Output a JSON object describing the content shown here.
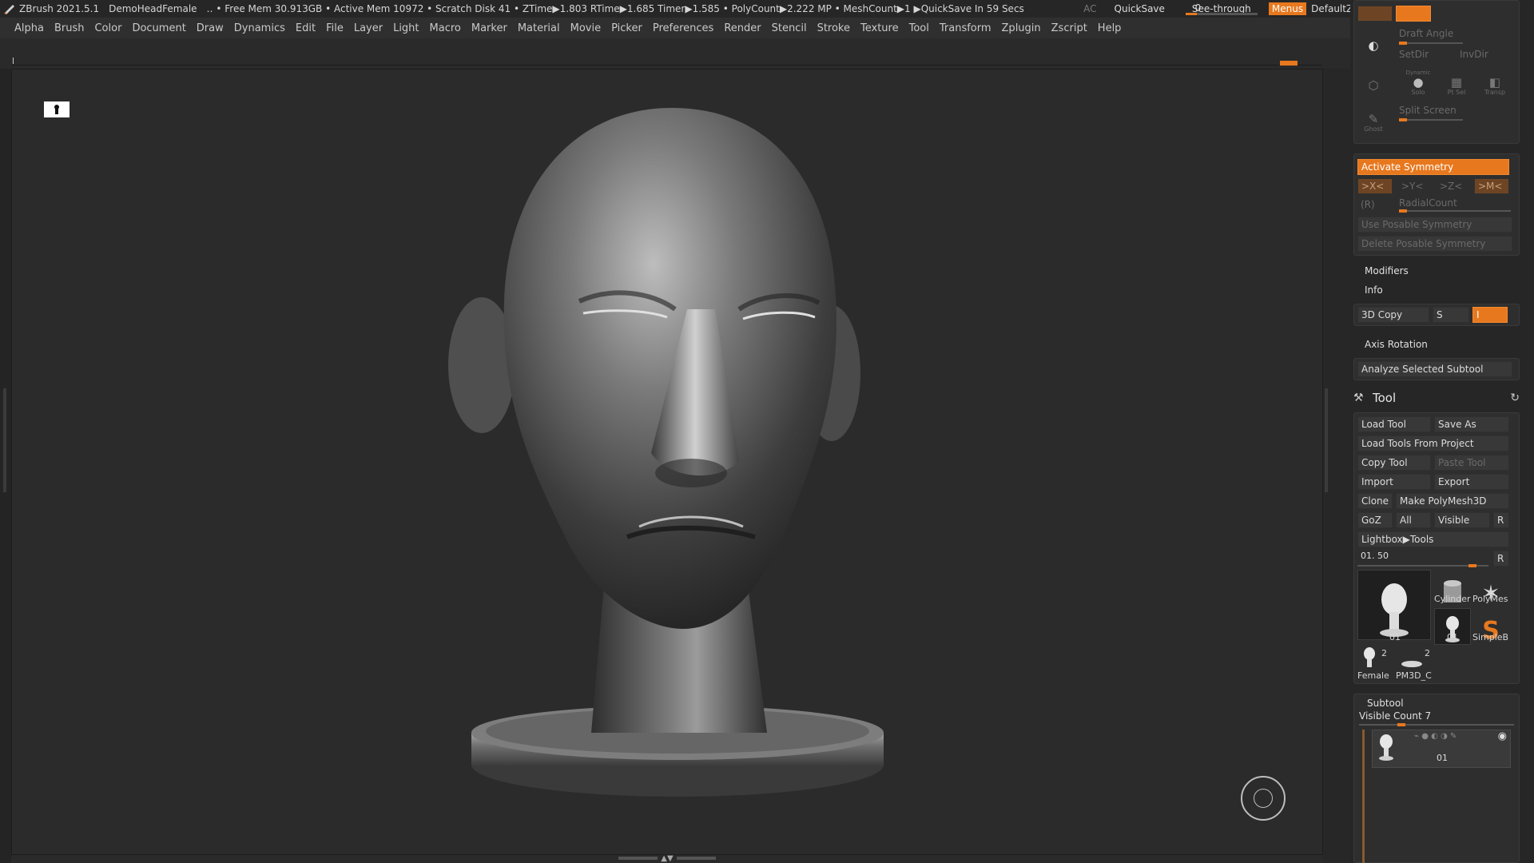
{
  "titlebar": {
    "app": "ZBrush 2021.5.1",
    "document": "DemoHeadFemale",
    "stats": "‥ • Free Mem 30.913GB • Active Mem 10972 • Scratch Disk 41 • ZTime▶1.803 RTime▶1.685 Timer▶1.585 • PolyCount▶2.222 MP • MeshCount▶1 ▶QuickSave In 59 Secs",
    "ac": "AC",
    "quicksave": "QuickSave",
    "see_through_label": "See-through",
    "see_through_value": "0",
    "see_through_fraction": 0.0,
    "menus": "Menus",
    "default_zscript": "DefaultZScript"
  },
  "menubar": {
    "items": [
      "Alpha",
      "Brush",
      "Color",
      "Document",
      "Draw",
      "Dynamics",
      "Edit",
      "File",
      "Layer",
      "Light",
      "Macro",
      "Marker",
      "Material",
      "Movie",
      "Picker",
      "Preferences",
      "Render",
      "Stencil",
      "Stroke",
      "Texture",
      "Tool",
      "Transform",
      "Zplugin",
      "Zscript",
      "Help"
    ]
  },
  "colors": {
    "accent": "#e8781e",
    "panel_bg": "#262626",
    "canvas_bg": "#2b2b2b",
    "button_bg": "#383838"
  },
  "panel": {
    "draft_angle": "Draft Angle",
    "set_dir": "SetDir",
    "inv_dir": "InvDir",
    "dynamic": "Dynamic",
    "solo": "Solo",
    "pt_sel": "Pt Sel",
    "transp": "Transp",
    "ghost": "Ghost",
    "split_screen": "Split Screen",
    "activate_symmetry": "Activate Symmetry",
    "sym_x": ">X<",
    "sym_y": ">Y<",
    "sym_z": ">Z<",
    "sym_m": ">M<",
    "sym_r": "(R)",
    "radial_count": "RadialCount",
    "use_posable_symmetry": "Use Posable Symmetry",
    "delete_posable_symmetry": "Delete Posable Symmetry",
    "modifiers": "Modifiers",
    "info": "Info",
    "copy_3d": "3D Copy",
    "copy_s": "S",
    "copy_i": "I",
    "axis_rotation": "Axis Rotation",
    "analyze_selected_subtool": "Analyze Selected Subtool"
  },
  "tool": {
    "title": "Tool",
    "load_tool": "Load Tool",
    "save_as": "Save As",
    "load_tools_from_project": "Load Tools From Project",
    "copy_tool": "Copy Tool",
    "paste_tool": "Paste Tool",
    "import": "Import",
    "export": "Export",
    "clone": "Clone",
    "make_polymesh3d": "Make PolyMesh3D",
    "goz": "GoZ",
    "all": "All",
    "visible": "Visible",
    "r": "R",
    "lightbox_tools": "Lightbox▶Tools",
    "slider_value": "01. 50",
    "slider_fraction": 0.85,
    "thumbs": [
      {
        "label": "01"
      },
      {
        "label": "Cylinder"
      },
      {
        "label": "PolyMes"
      },
      {
        "label": "01"
      },
      {
        "label": "SimpleB"
      },
      {
        "label": "Female",
        "count": "2"
      },
      {
        "label": "PM3D_C",
        "count": "2"
      }
    ]
  },
  "subtool": {
    "title": "Subtool",
    "visible_count": "Visible Count 7",
    "item_label": "01"
  }
}
